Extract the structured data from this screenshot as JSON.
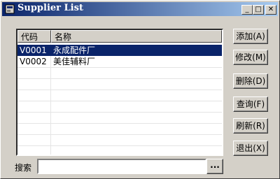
{
  "window": {
    "title": "Supplier List"
  },
  "titlebar_buttons": {
    "minimize": "_",
    "maximize": "□",
    "close": "✕"
  },
  "list": {
    "columns": [
      "代码",
      "名称"
    ],
    "rows": [
      {
        "code": "V0001",
        "name": "永成配件厂",
        "selected": true
      },
      {
        "code": "V0002",
        "name": "美佳辅料厂",
        "selected": false
      }
    ]
  },
  "buttons": {
    "add": "添加(A)",
    "modify": "修改(M)",
    "delete": "删除(D)",
    "query": "查询(F)",
    "refresh": "刷新(R)",
    "exit": "退出(X)"
  },
  "search": {
    "label": "搜索",
    "value": "",
    "browse_label": "..."
  },
  "colors": {
    "title_start": "#0a246a",
    "title_end": "#a6caf0",
    "selection": "#0a246a"
  }
}
